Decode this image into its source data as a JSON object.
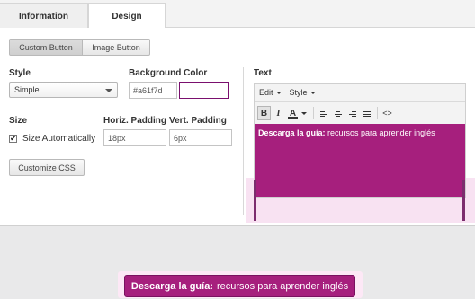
{
  "tabs": [
    {
      "label": "Information",
      "active": false
    },
    {
      "label": "Design",
      "active": true
    }
  ],
  "button_type": {
    "custom_label": "Custom Button",
    "image_label": "Image Button",
    "selected": "Custom Button"
  },
  "style": {
    "label": "Style",
    "value": "Simple"
  },
  "background_color": {
    "label": "Background Color",
    "value": "#a61f7d",
    "swatch": "#a61f7d"
  },
  "size": {
    "label": "Size",
    "auto_label": "Size Automatically",
    "auto_checked": true
  },
  "horiz_padding": {
    "label": "Horiz. Padding",
    "value": "18px"
  },
  "vert_padding": {
    "label": "Vert. Padding",
    "value": "6px"
  },
  "customize_css_label": "Customize CSS",
  "text_editor": {
    "label": "Text",
    "menus": [
      "Edit",
      "Style"
    ],
    "toolbar": [
      "bold-icon",
      "italic-icon",
      "text-color-icon",
      "align-left-icon",
      "align-center-icon",
      "align-right-icon",
      "align-justify-icon",
      "source-code-icon"
    ],
    "content_bold": "Descarga la guía:",
    "content_rest": " recursos para aprender inglés"
  },
  "preview": {
    "bold": "Descarga la guía:",
    "rest": "recursos para aprender inglés"
  },
  "colors": {
    "accent": "#a61f7d",
    "accent_dark": "#7a1160"
  }
}
